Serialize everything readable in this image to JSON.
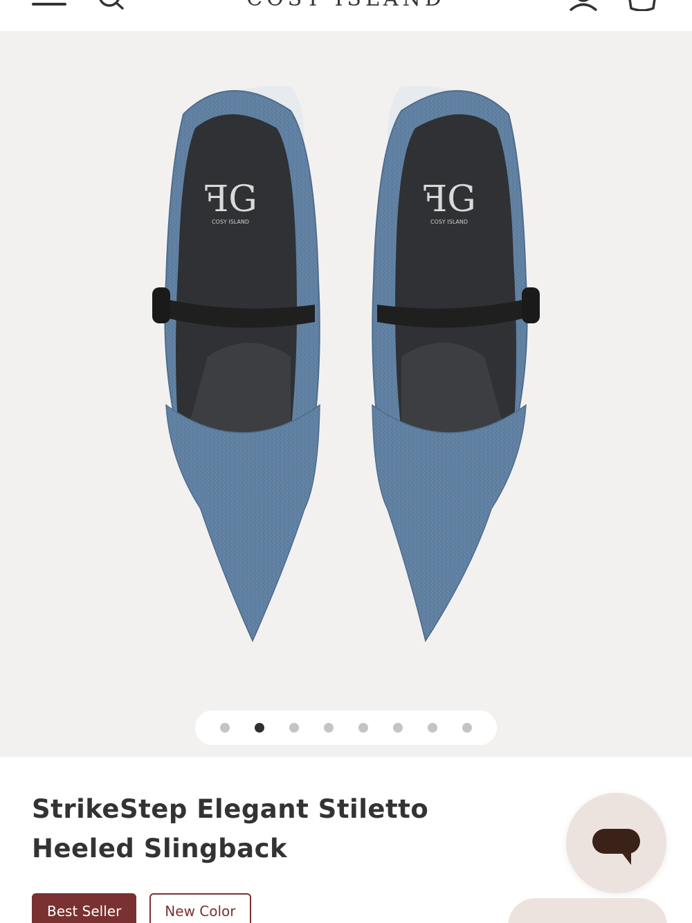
{
  "header": {
    "brand": "COSY ISLAND",
    "icons": [
      "menu-icon",
      "search-icon",
      "account-icon",
      "cart-icon"
    ]
  },
  "gallery": {
    "insole_brand": "COSY ISLAND",
    "slide_count": 8,
    "active_slide": 2
  },
  "product": {
    "title": "StrikeStep Elegant Stiletto Heeled Slingback",
    "badges": [
      "Best Seller",
      "New Color"
    ]
  },
  "colors": {
    "badge_accent": "#7a3131",
    "gallery_bg": "#f3f1f0",
    "chat_bg": "#ece3df",
    "denim": "#5f7fa0"
  }
}
